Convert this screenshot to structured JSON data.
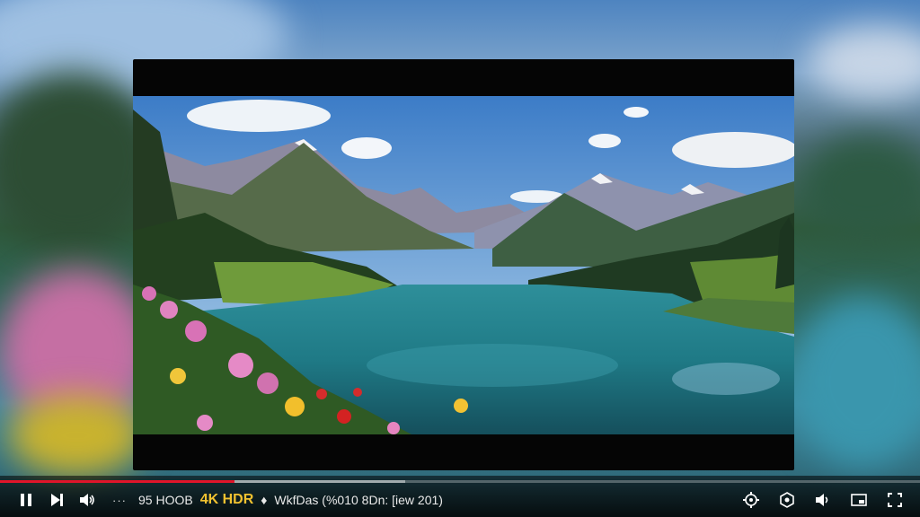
{
  "player": {
    "progress_fraction": 0.255,
    "buffer_fraction": 0.44,
    "accent_color": "#e0152a"
  },
  "controls": {
    "more_dots": "···",
    "resolution_text": "95 HOOB",
    "quality_badge": "4K HDR",
    "meta_marker": "♦",
    "meta_text": "WkfDas (%010 8Dn: [iew 201)"
  },
  "icons": {
    "play_pause": "pause-icon",
    "next": "next-icon",
    "volume": "volume-icon",
    "settings": "settings-icon",
    "captions": "captions-icon",
    "speaker": "speaker-icon",
    "miniplayer": "miniplayer-icon",
    "fullscreen": "fullscreen-icon"
  }
}
